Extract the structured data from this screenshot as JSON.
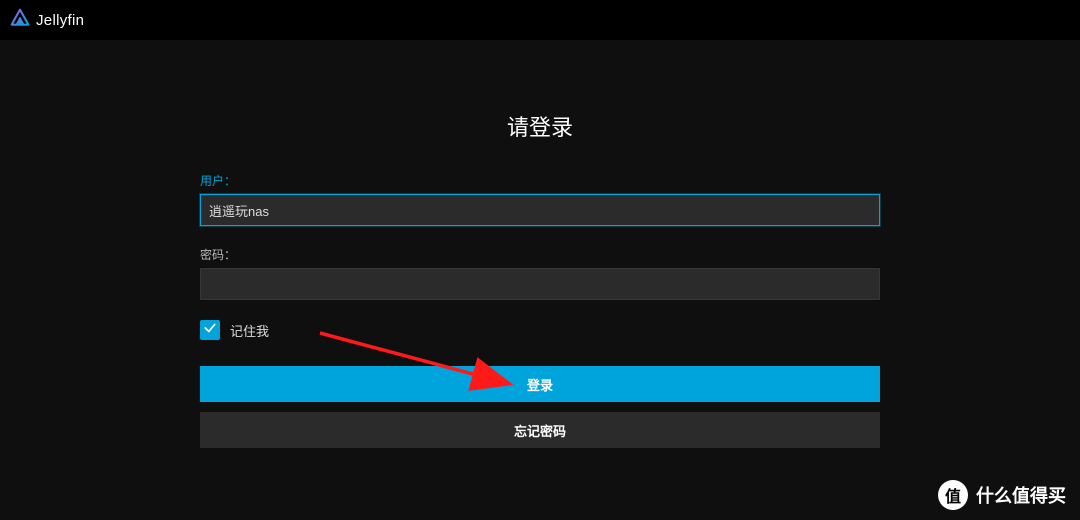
{
  "brand": {
    "name": "Jellyfin"
  },
  "login": {
    "title": "请登录",
    "username_label": "用户：",
    "username_value": "逍遥玩nas",
    "password_label": "密码：",
    "password_value": "",
    "remember_label": "记住我",
    "remember_checked": true,
    "submit_label": "登录",
    "forgot_label": "忘记密码"
  },
  "watermark": {
    "badge": "值",
    "text": "什么值得买"
  },
  "colors": {
    "accent": "#00a4dc",
    "bg": "#0f0f0f",
    "input_bg": "#2b2b2b"
  }
}
